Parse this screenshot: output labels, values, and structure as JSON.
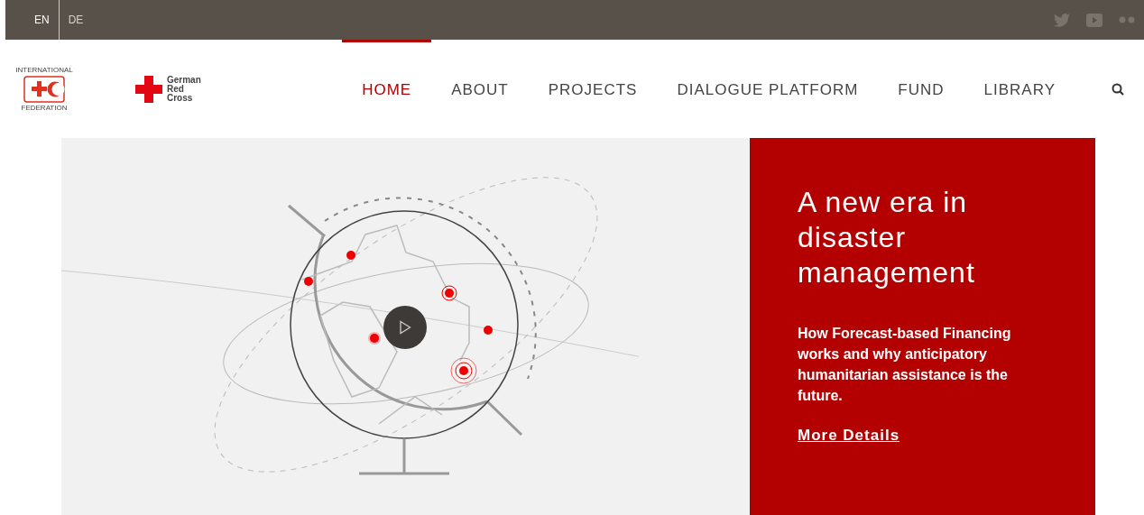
{
  "language_switcher": [
    {
      "label": "EN",
      "selected": true
    },
    {
      "label": "DE",
      "selected": false
    }
  ],
  "logos": {
    "federation": {
      "top": "INTERNATIONAL",
      "bottom": "FEDERATION"
    },
    "red_cross": {
      "lines": [
        "German",
        "Red",
        "Cross"
      ]
    }
  },
  "nav": [
    {
      "label": "HOME",
      "selected": true
    },
    {
      "label": "ABOUT",
      "selected": false
    },
    {
      "label": "PROJECTS",
      "selected": false
    },
    {
      "label": "DIALOGUE PLATFORM",
      "selected": false
    },
    {
      "label": "FUND",
      "selected": false
    },
    {
      "label": "LIBRARY",
      "selected": false
    }
  ],
  "hero": {
    "title": "A new era in disaster management",
    "text": "How Forecast-based Financing works and why anticipatory humanitarian assistance is the future.",
    "link": "More Details"
  }
}
